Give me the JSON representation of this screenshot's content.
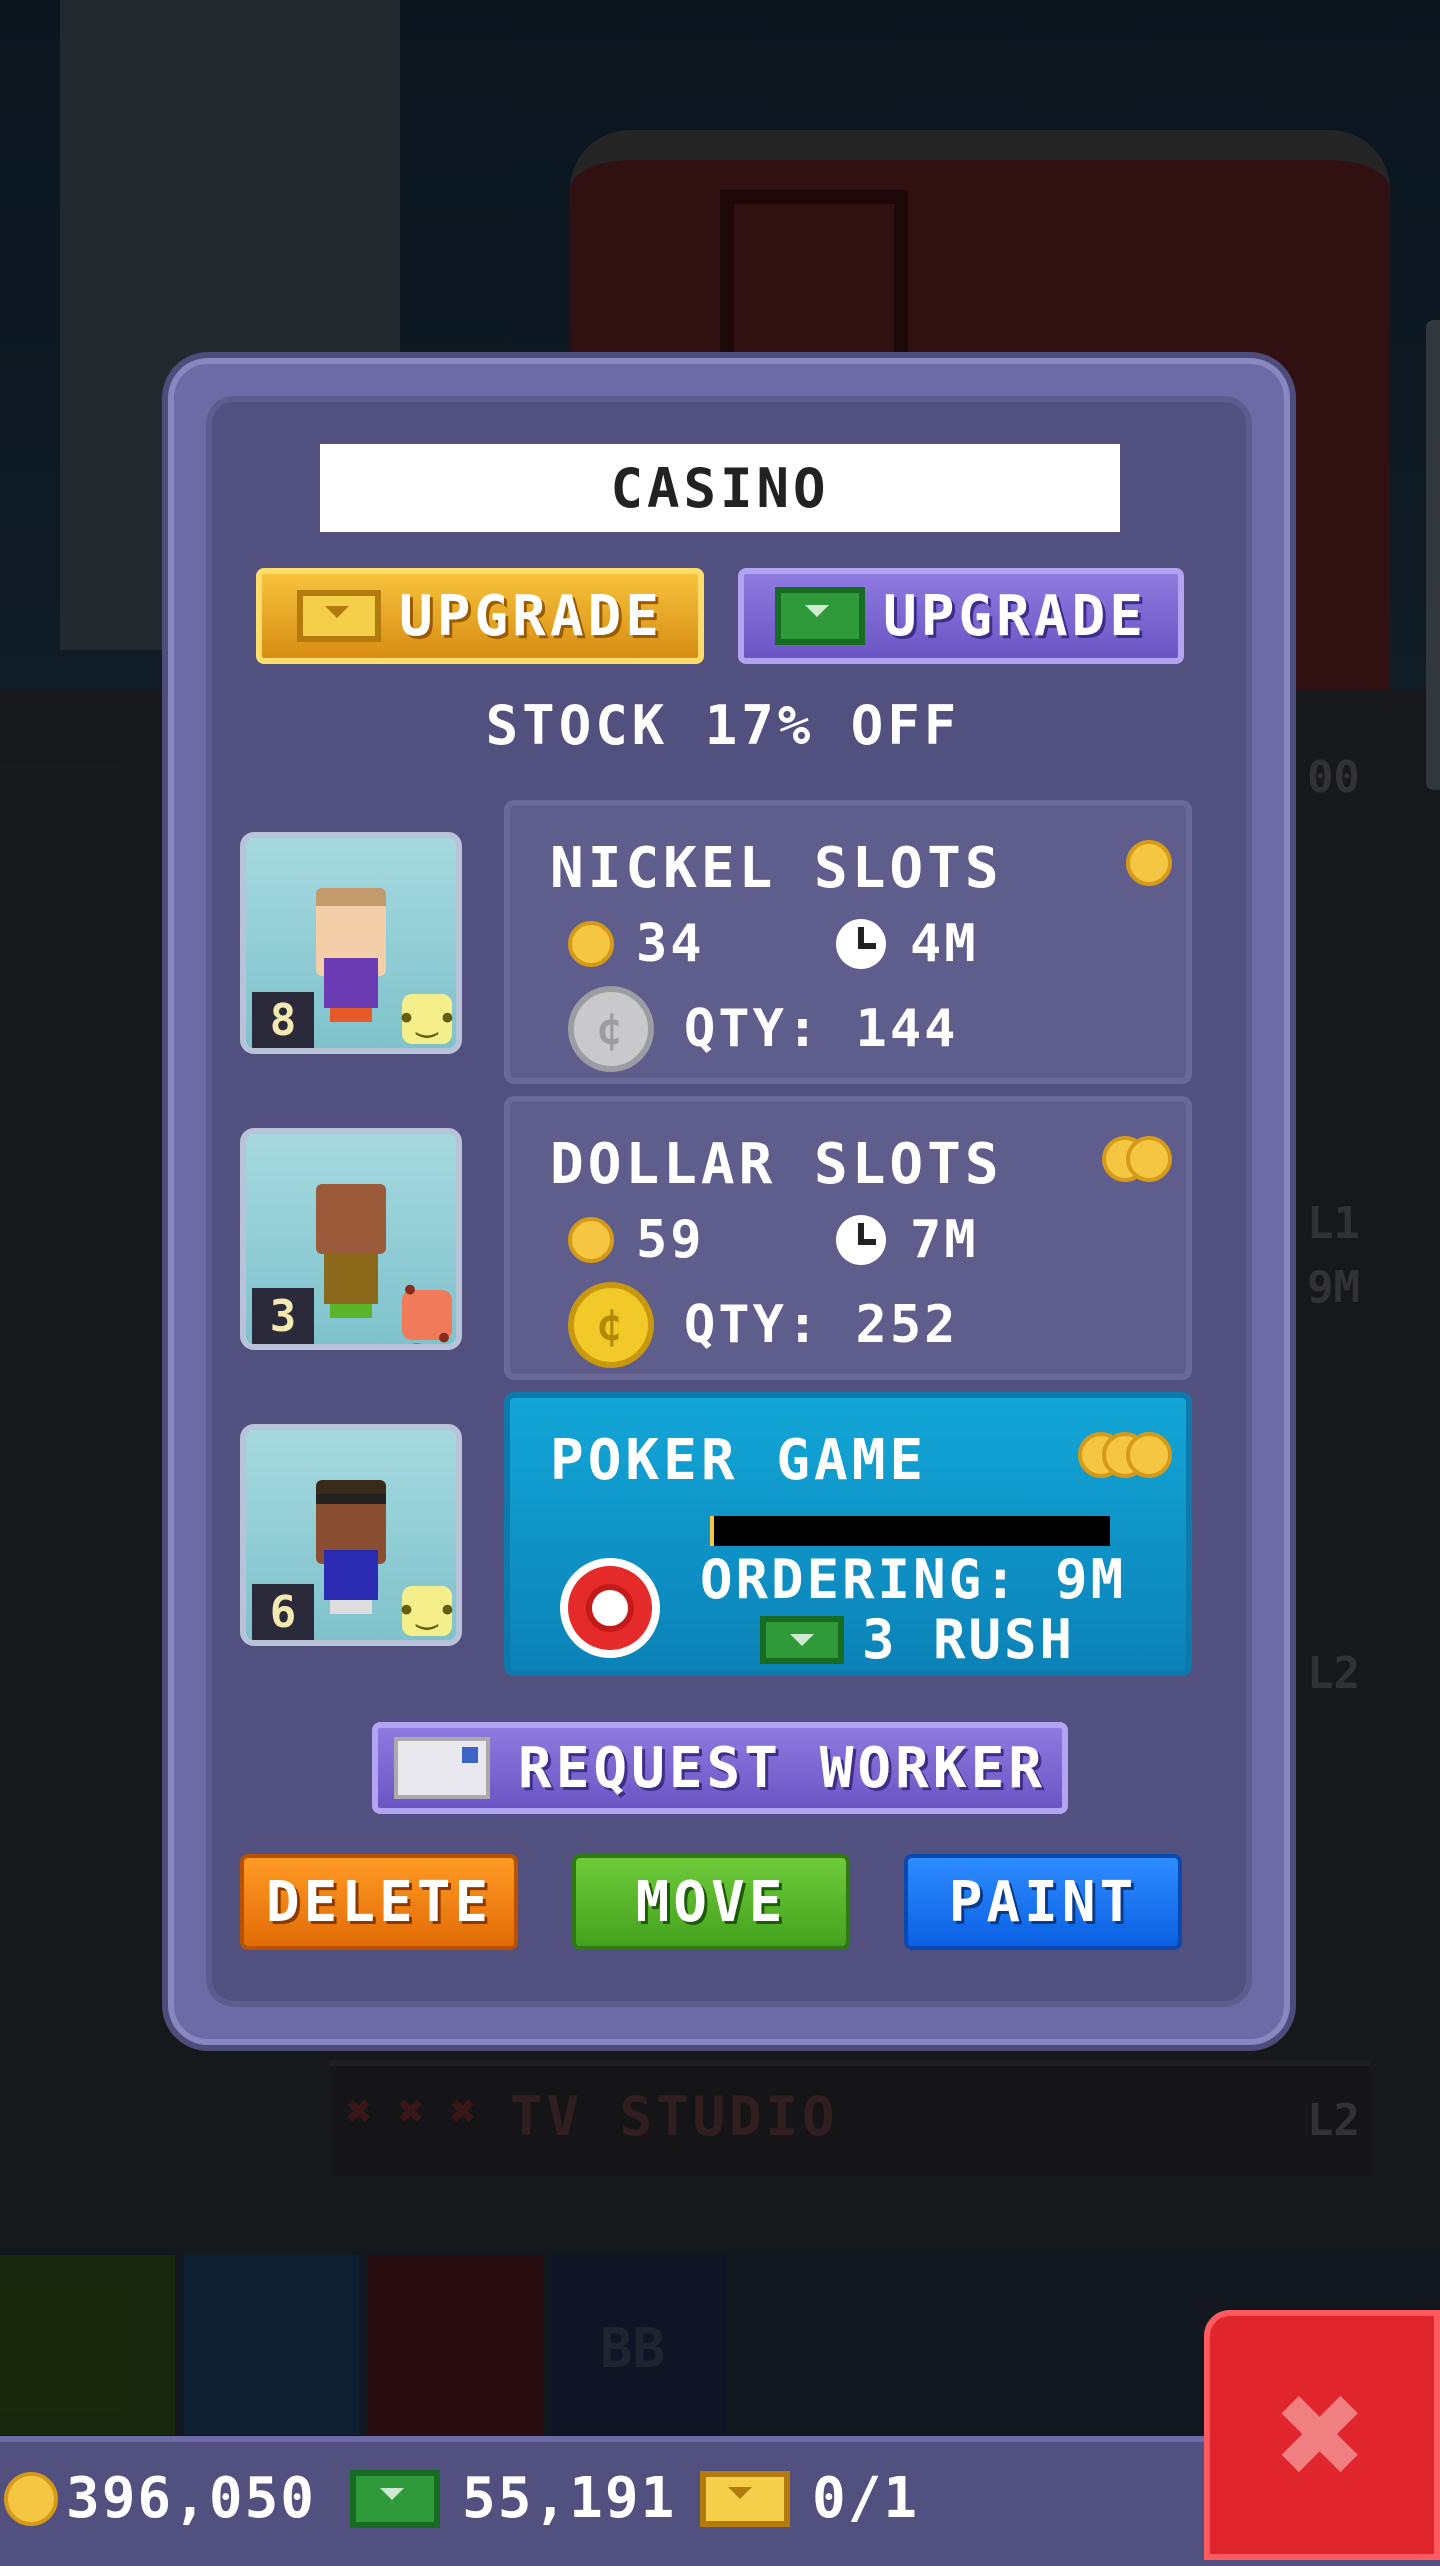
{
  "dialog": {
    "title": "CASINO",
    "upgrade_gold_label": "UPGRADE",
    "upgrade_bux_label": "UPGRADE",
    "discount_text": "STOCK 17% OFF",
    "request_worker_label": "REQUEST WORKER",
    "delete_label": "DELETE",
    "move_label": "MOVE",
    "paint_label": "PAINT"
  },
  "workers": [
    {
      "level": "8",
      "mood": "neutral"
    },
    {
      "level": "3",
      "mood": "unhappy"
    },
    {
      "level": "6",
      "mood": "neutral"
    }
  ],
  "products": [
    {
      "name": "NICKEL SLOTS",
      "cost": "34",
      "time": "4M",
      "qty": "QTY: 144",
      "tier": 1
    },
    {
      "name": "DOLLAR SLOTS",
      "cost": "59",
      "time": "7M",
      "qty": "QTY: 252",
      "tier": 2
    },
    {
      "name": "POKER GAME",
      "status": "ORDERING: 9M",
      "rush": "3 RUSH",
      "progress": 0.01,
      "tier": 3
    }
  ],
  "background": {
    "floor_label": "TV STUDIO",
    "floor_level": "L2",
    "side_tags": [
      "00",
      "L1",
      "9M",
      "L2"
    ],
    "toolbar_bb": "BB"
  },
  "status_bar": {
    "coins": "396,050",
    "bux": "55,191",
    "tickets": "0/1"
  },
  "colors": {
    "dialog_bg": "#51507f",
    "active_product": "#13a6d7",
    "close_red": "#e0252c"
  }
}
